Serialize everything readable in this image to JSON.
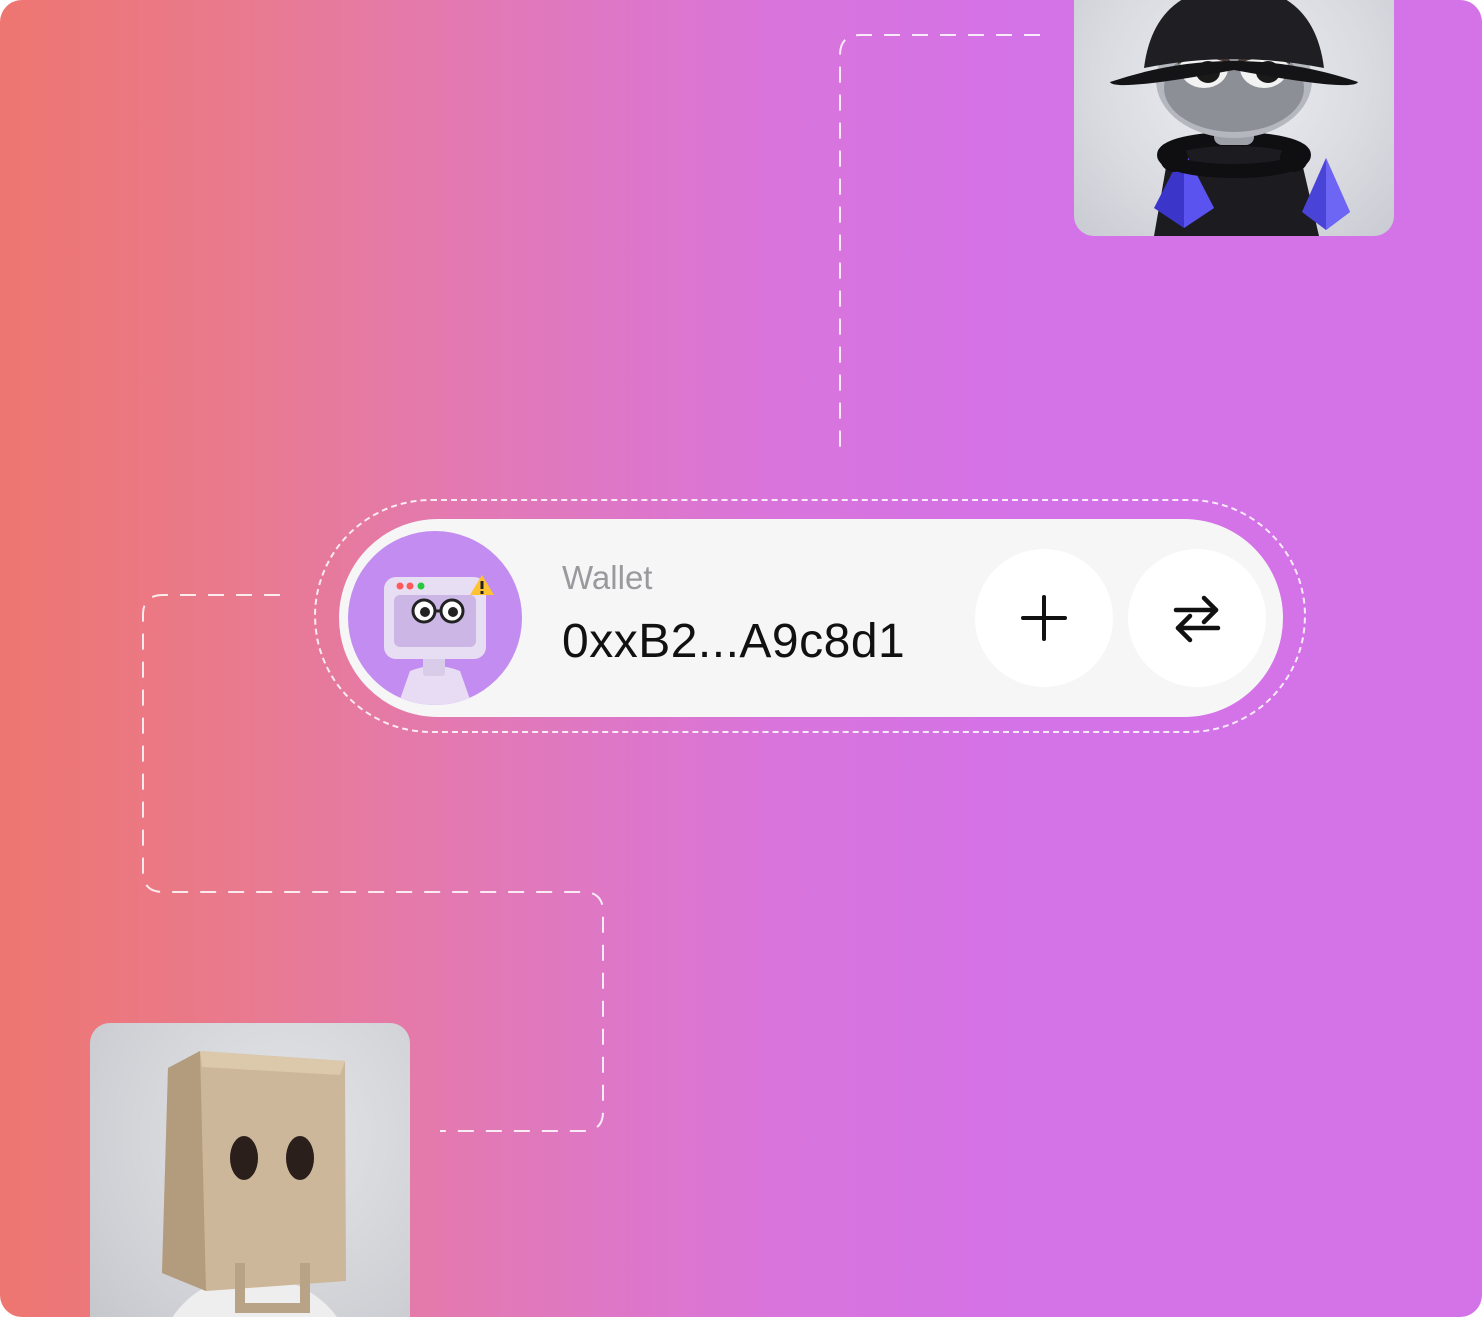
{
  "wallet": {
    "label": "Wallet",
    "address": "0xxB2...A9c8d1"
  },
  "actions": {
    "add_icon": "plus-icon",
    "swap_icon": "swap-arrows-icon"
  },
  "colors": {
    "gradient_left": "#ee7670",
    "gradient_right": "#d472e8",
    "card_background": "#f6f6f7",
    "avatar_background": "#c38cf0",
    "label_color": "#9a9a9e",
    "address_color": "#111111"
  }
}
